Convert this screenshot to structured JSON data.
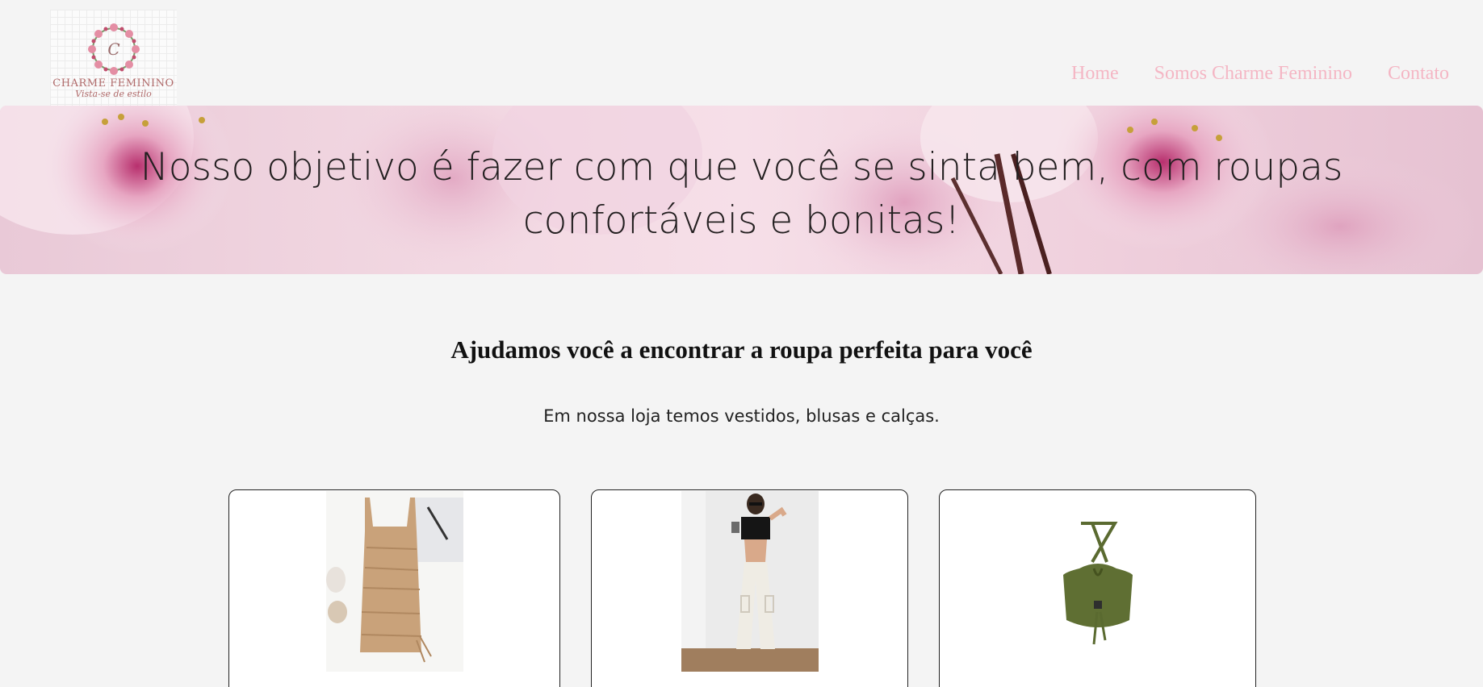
{
  "header": {
    "logo": {
      "letter": "C",
      "name": "CHARME FEMININO",
      "slogan": "Vista-se de estilo"
    },
    "nav": [
      {
        "label": "Home"
      },
      {
        "label": "Somos Charme Feminino"
      },
      {
        "label": "Contato"
      }
    ],
    "nav_color": "#f4b6c4"
  },
  "hero": {
    "title": "Nosso objetivo é fazer com que você se sinta bem, com roupas confortáveis e bonitas!",
    "background": "pink-cherry-blossoms-image"
  },
  "intro": {
    "heading": "Ajudamos você a encontrar a roupa perfeita para você",
    "text": "Em nossa loja temos vestidos, blusas e calças."
  },
  "products": [
    {
      "image": "beige-ruched-dress-image"
    },
    {
      "image": "black-top-cargo-pants-image"
    },
    {
      "image": "green-halter-top-image"
    }
  ]
}
